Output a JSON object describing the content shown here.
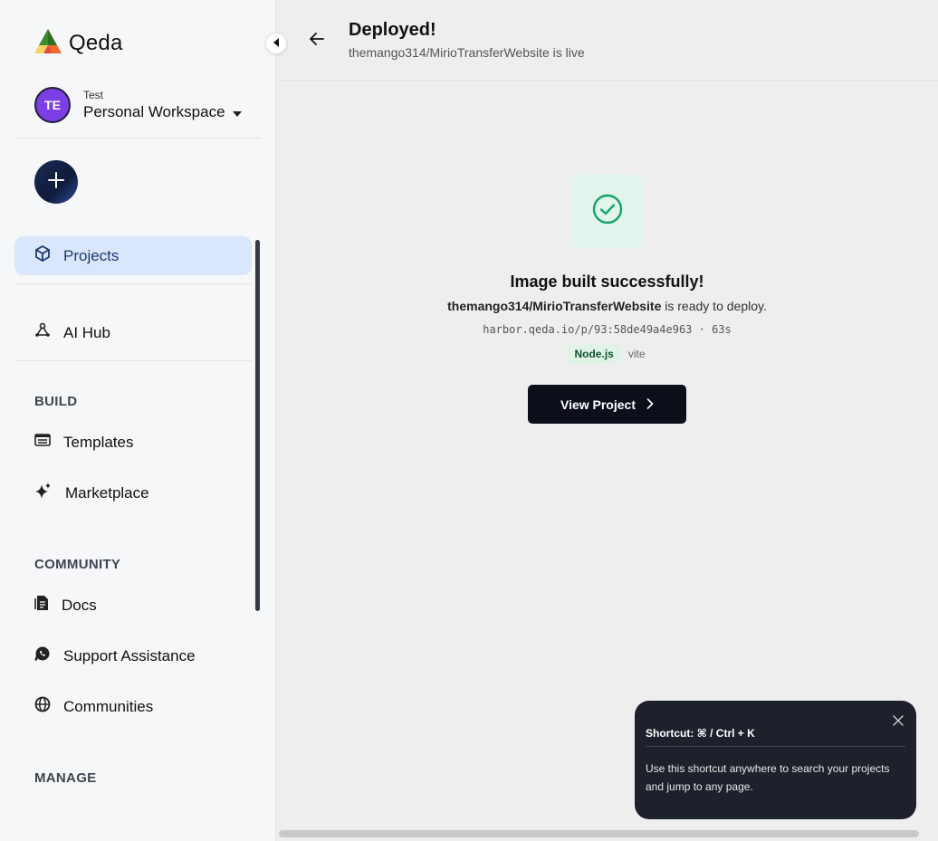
{
  "app": {
    "brand": "Qeda"
  },
  "workspace": {
    "small_label": "Test",
    "name": "Personal Workspace",
    "initials": "TE"
  },
  "sidebar": {
    "items": [
      {
        "label": "Projects",
        "icon": "cube-icon"
      },
      {
        "label": "AI Hub",
        "icon": "ai-hub-icon"
      }
    ],
    "sections": [
      {
        "title": "BUILD",
        "items": [
          {
            "label": "Templates",
            "icon": "templates-icon"
          },
          {
            "label": "Marketplace",
            "icon": "sparkle-icon"
          }
        ]
      },
      {
        "title": "COMMUNITY",
        "items": [
          {
            "label": "Docs",
            "icon": "docs-icon"
          },
          {
            "label": "Support Assistance",
            "icon": "whatsapp-icon"
          },
          {
            "label": "Communities",
            "icon": "globe-icon"
          }
        ]
      },
      {
        "title": "MANAGE",
        "items": []
      }
    ]
  },
  "header": {
    "title": "Deployed!",
    "subtitle": "themango314/MirioTransferWebsite is live"
  },
  "status": {
    "title": "Image built successfully!",
    "repo": "themango314/MirioTransferWebsite",
    "ready_suffix": " is ready to deploy.",
    "image_line": "harbor.qeda.io/p/93:58de49a4e963 · 63s",
    "runtime_tag": "Node.js",
    "framework_tag": "vite"
  },
  "actions": {
    "view_project": "View Project"
  },
  "toast": {
    "title": "Shortcut: ⌘ / Ctrl + K",
    "body": "Use this shortcut anywhere to search your projects and jump to any page."
  },
  "colors": {
    "accent_active": "#d9e6fb",
    "success": "#16a36a",
    "button_dark": "#0b0f1a"
  }
}
